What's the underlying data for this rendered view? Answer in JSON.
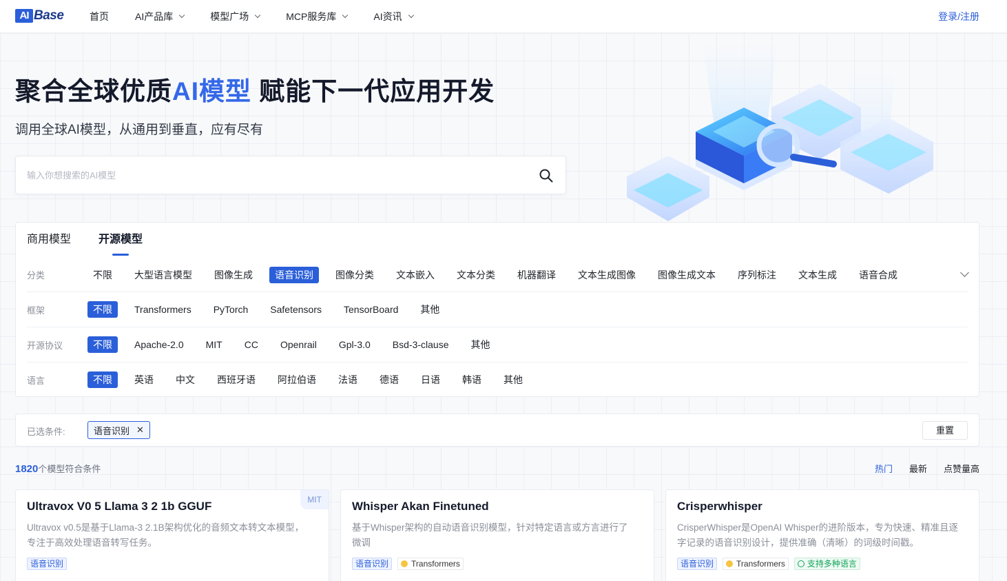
{
  "brand": {
    "logo_box": "AI",
    "logo_text": "Base"
  },
  "nav": {
    "items": [
      {
        "label": "首页",
        "has_dropdown": false
      },
      {
        "label": "AI产品库",
        "has_dropdown": true
      },
      {
        "label": "模型广场",
        "has_dropdown": true
      },
      {
        "label": "MCP服务库",
        "has_dropdown": true
      },
      {
        "label": "AI资讯",
        "has_dropdown": true
      }
    ],
    "login": "登录/注册"
  },
  "hero": {
    "title_before": "聚合全球优质",
    "title_highlight": "AI模型",
    "title_after": " 赋能下一代应用开发",
    "subtitle": "调用全球AI模型，从通用到垂直，应有尽有",
    "search_placeholder": "输入你想搜索的AI模型"
  },
  "tabs": [
    {
      "label": "商用模型",
      "active": false
    },
    {
      "label": "开源模型",
      "active": true
    }
  ],
  "filters": {
    "category": {
      "label": "分类",
      "options": [
        "不限",
        "大型语言模型",
        "图像生成",
        "语音识别",
        "图像分类",
        "文本嵌入",
        "文本分类",
        "机器翻译",
        "文本生成图像",
        "图像生成文本",
        "序列标注",
        "文本生成",
        "语音合成"
      ],
      "selected": "语音识别"
    },
    "framework": {
      "label": "框架",
      "options": [
        "不限",
        "Transformers",
        "PyTorch",
        "Safetensors",
        "TensorBoard",
        "其他"
      ],
      "selected": "不限"
    },
    "license": {
      "label": "开源协议",
      "options": [
        "不限",
        "Apache-2.0",
        "MIT",
        "CC",
        "Openrail",
        "Gpl-3.0",
        "Bsd-3-clause",
        "其他"
      ],
      "selected": "不限"
    },
    "language": {
      "label": "语言",
      "options": [
        "不限",
        "英语",
        "中文",
        "西班牙语",
        "阿拉伯语",
        "法语",
        "德语",
        "日语",
        "韩语",
        "其他"
      ],
      "selected": "不限"
    }
  },
  "selected_bar": {
    "label": "已选条件:",
    "chip": "语音识别",
    "reset": "重置"
  },
  "results": {
    "count": "1820",
    "count_suffix": "个模型符合条件"
  },
  "sorts": [
    {
      "label": "热门",
      "active": true
    },
    {
      "label": "最新",
      "active": false
    },
    {
      "label": "点赞量高",
      "active": false
    }
  ],
  "cards": [
    {
      "title": "Ultravox V0 5 Llama 3 2 1b GGUF",
      "desc": "Ultravox v0.5是基于Llama-3 2.1B架构优化的音频文本转文本模型，专注于高效处理语音转写任务。",
      "badge": "MIT",
      "tags": [
        {
          "text": "语音识别",
          "style": "blue"
        }
      ]
    },
    {
      "title": "Whisper Akan Finetuned",
      "desc": "基于Whisper架构的自动语音识别模型，针对特定语言或方言进行了微调",
      "badge": "",
      "tags": [
        {
          "text": "语音识别",
          "style": "blue"
        },
        {
          "text": "Transformers",
          "style": "gray"
        }
      ]
    },
    {
      "title": "Crisperwhisper",
      "desc": "CrisperWhisper是OpenAI Whisper的进阶版本，专为快速、精准且逐字记录的语音识别设计，提供准确（清晰）的词级时间戳。",
      "badge": "",
      "tags": [
        {
          "text": "语音识别",
          "style": "blue"
        },
        {
          "text": "Transformers",
          "style": "gray"
        },
        {
          "text": "支持多种语言",
          "style": "green"
        }
      ]
    }
  ],
  "colors": {
    "accent": "#2b5fd9",
    "title_dark": "#141a2b",
    "muted": "#8a8f99"
  }
}
